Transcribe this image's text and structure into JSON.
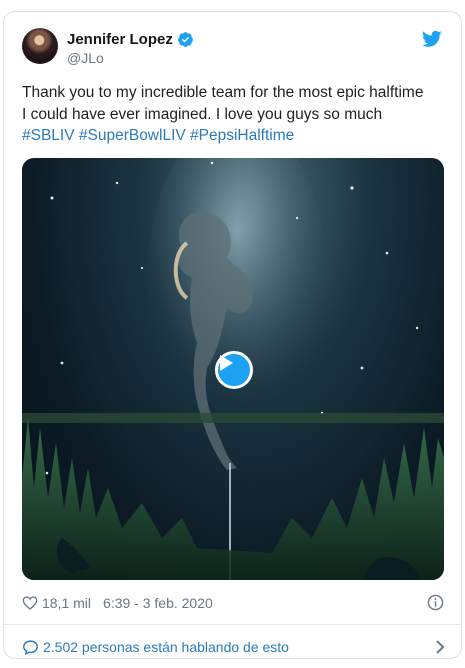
{
  "tweet": {
    "author_name": "Jennifer Lopez",
    "handle": "@JLo",
    "text_line1": "Thank you to my incredible team for the most epic halftime",
    "text_line2": "I could have ever imagined. I love you guys so much",
    "hashtags": "#SBLIV #SuperBowlLIV #PepsiHalftime",
    "like_count": "18,1 mil",
    "timestamp": "6:39 - 3 feb. 2020",
    "conversation_text": "2.502 personas están hablando de esto"
  },
  "icons": {
    "verified": "verified-badge-icon",
    "brand": "twitter-bird-icon",
    "like": "heart-icon",
    "info": "info-icon",
    "reply": "speech-bubble-icon",
    "more": "chevron-right-icon",
    "play": "play-icon"
  },
  "colors": {
    "accent": "#1da1f2",
    "link": "#2b7bb9",
    "meta_text": "#697882"
  }
}
